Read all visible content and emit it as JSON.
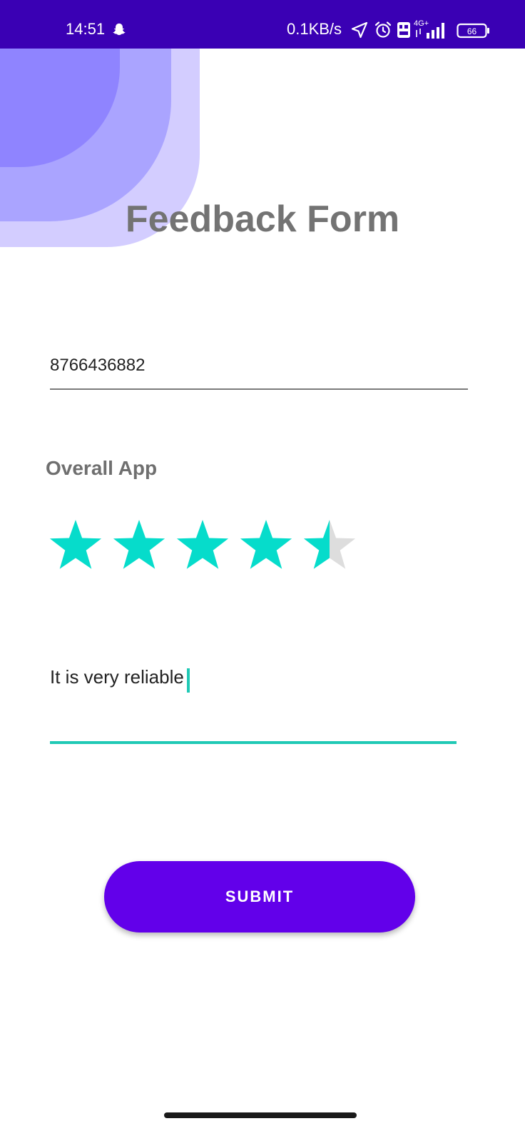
{
  "status_bar": {
    "time": "14:51",
    "network_speed": "0.1KB/s",
    "battery_level": "66",
    "network_type": "4G+",
    "background_color": "#3a00b4",
    "icons": [
      "snapchat-icon",
      "navigation-icon",
      "alarm-icon",
      "volte-icon",
      "signal-icon",
      "battery-icon"
    ]
  },
  "form": {
    "title": "Feedback Form",
    "phone_value": "8766436882",
    "rating_label": "Overall App",
    "rating": {
      "value": 4.5,
      "max": 5,
      "filled_color": "#06dccb",
      "empty_color": "#dddddd"
    },
    "comment_value": "It is very reliable",
    "accent_color": "#20c9b5",
    "submit_label": "SUBMIT",
    "submit_color": "#6200ea"
  }
}
